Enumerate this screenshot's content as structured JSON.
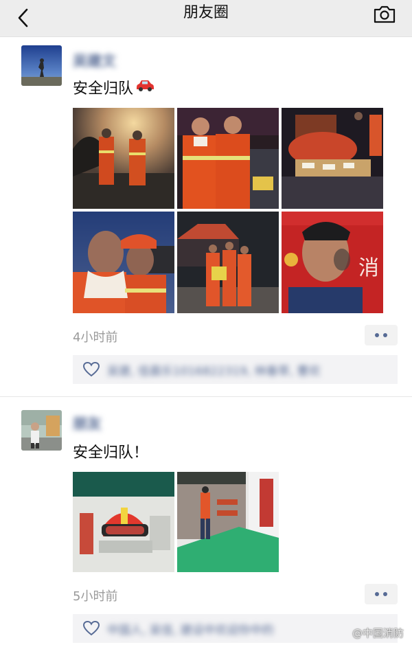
{
  "header": {
    "title": "朋友圈",
    "back_icon": "chevron-left-icon",
    "camera_icon": "camera-icon",
    "background": "#ededed"
  },
  "posts": [
    {
      "username": "吴建文",
      "text": "安全归队",
      "emoji": "car-icon",
      "time": "4小时前",
      "likes": "吴建, 佳晨乐1016822319, 林春草, 曹欢"
    },
    {
      "username": "朋友",
      "text": "安全归队！",
      "time": "5小时前",
      "likes": "中国人, 吴佳, 建设中欢迎你中的"
    }
  ],
  "watermark": "@中国消防",
  "colors": {
    "link": "#576b95",
    "time": "#9a9a9a",
    "likes_bg": "#f3f3f5"
  }
}
